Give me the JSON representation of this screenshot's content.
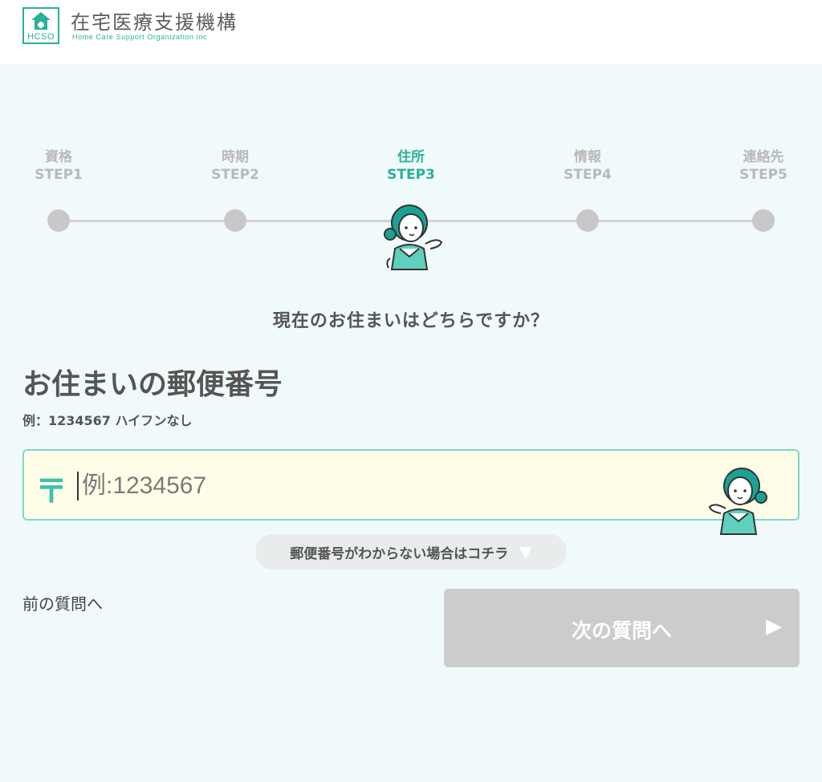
{
  "header": {
    "logo_abbr": "HCSO",
    "org_name": "在宅医療支援機構",
    "org_sub": "Home Care Support Organization inc"
  },
  "steps": [
    {
      "label": "資格",
      "step": "STEP1",
      "active": false
    },
    {
      "label": "時期",
      "step": "STEP2",
      "active": false
    },
    {
      "label": "住所",
      "step": "STEP3",
      "active": true
    },
    {
      "label": "情報",
      "step": "STEP4",
      "active": false
    },
    {
      "label": "連絡先",
      "step": "STEP5",
      "active": false
    }
  ],
  "question": "現在のお住まいはどちらですか？",
  "form": {
    "title": "お住まいの郵便番号",
    "hint": "例：1234567 ハイフンなし",
    "postal_symbol": "〒",
    "placeholder": "例:1234567",
    "value": ""
  },
  "help_toggle": {
    "label": "郵便番号がわからない場合はコチラ",
    "arrow": "▼"
  },
  "nav": {
    "prev_label": "前の質問へ",
    "next_label": "次の質問へ",
    "next_arrow": "▶"
  },
  "colors": {
    "accent": "#2aaf9a",
    "background": "#f1fafb",
    "input_bg": "#fefee8",
    "disabled_button": "#cccccc",
    "inactive_step": "#c8c8c8"
  }
}
